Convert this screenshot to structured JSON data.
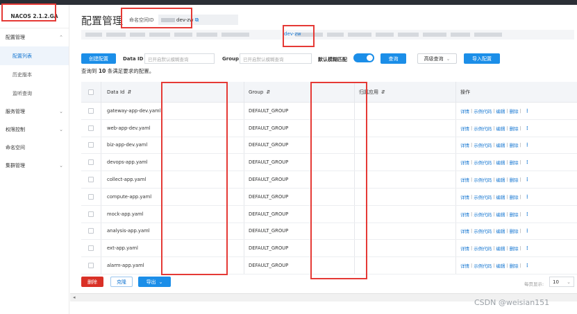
{
  "brand": "NACOS 2.1.2.GA",
  "sidebar": {
    "items": [
      {
        "label": "配置管理",
        "type": "group",
        "expanded": true
      },
      {
        "label": "配置列表",
        "type": "sub",
        "active": true
      },
      {
        "label": "历史版本",
        "type": "sub"
      },
      {
        "label": "监听查询",
        "type": "sub"
      },
      {
        "label": "服务管理",
        "type": "group"
      },
      {
        "label": "权限控制",
        "type": "group"
      },
      {
        "label": "命名空间",
        "type": "plain"
      },
      {
        "label": "集群管理",
        "type": "group"
      }
    ]
  },
  "header": {
    "title": "配置管理",
    "namespace_label": "命名空间ID",
    "namespace_value": "dev-zw",
    "namespace_tab": "dev-zw"
  },
  "toolbar": {
    "create_label": "创建配置",
    "dataid_label": "Data ID",
    "dataid_placeholder": "已开启默认模糊查询",
    "group_label": "Group",
    "group_placeholder": "已开启默认模糊查询",
    "fuzzy_label": "默认模糊匹配",
    "query_label": "查询",
    "advanced_label": "高级查询",
    "import_label": "导入配置"
  },
  "result": {
    "prefix": "查询到",
    "count": "10",
    "suffix": "条满足要求的配置。"
  },
  "table": {
    "headers": {
      "dataid": "Data Id",
      "group": "Group",
      "app": "归属应用",
      "ops": "操作"
    },
    "ops": {
      "detail": "详情",
      "sample": "示例代码",
      "edit": "编辑",
      "delete": "删除",
      "more": "⋮"
    },
    "rows": [
      {
        "dataid": "gateway-app-dev.yaml",
        "group": "DEFAULT_GROUP",
        "app": ""
      },
      {
        "dataid": "web-app-dev.yaml",
        "group": "DEFAULT_GROUP",
        "app": ""
      },
      {
        "dataid": "biz-app-dev.yaml",
        "group": "DEFAULT_GROUP",
        "app": ""
      },
      {
        "dataid": "devops-app.yaml",
        "group": "DEFAULT_GROUP",
        "app": ""
      },
      {
        "dataid": "collect-app.yaml",
        "group": "DEFAULT_GROUP",
        "app": ""
      },
      {
        "dataid": "compute-app.yaml",
        "group": "DEFAULT_GROUP",
        "app": ""
      },
      {
        "dataid": "mock-app.yaml",
        "group": "DEFAULT_GROUP",
        "app": ""
      },
      {
        "dataid": "analysis-app.yaml",
        "group": "DEFAULT_GROUP",
        "app": ""
      },
      {
        "dataid": "ext-app.yaml",
        "group": "DEFAULT_GROUP",
        "app": ""
      },
      {
        "dataid": "alarm-app.yaml",
        "group": "DEFAULT_GROUP",
        "app": ""
      }
    ]
  },
  "footer": {
    "delete_label": "删除",
    "clone_label": "克隆",
    "export_label": "导出",
    "pagesize_label": "每页显示:",
    "pagesize_value": "10"
  },
  "watermark": "CSDN @weisian151",
  "colors": {
    "primary": "#1b8ee8",
    "danger": "#d93026",
    "highlight": "#e53935"
  }
}
